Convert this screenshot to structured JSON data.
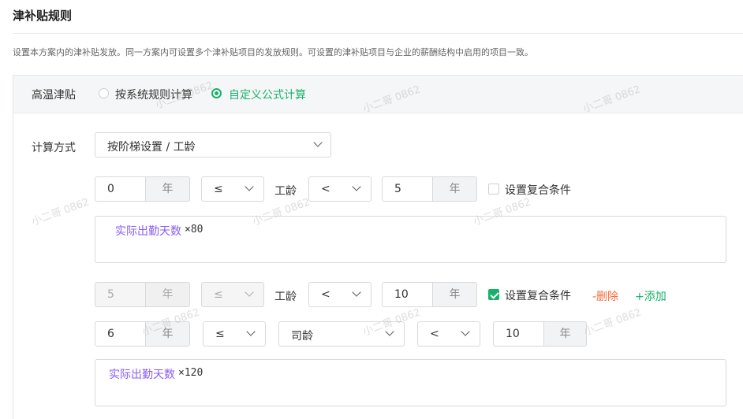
{
  "page": {
    "title": "津补贴规则",
    "description": "设置本方案内的津补贴发放。同一方案内可设置多个津补贴项目的发放规则。可设置的津补贴项目与企业的薪酬结构中启用的项目一致。"
  },
  "card": {
    "item_name": "高温津贴",
    "radio_options": [
      "按系统规则计算",
      "自定义公式计算"
    ],
    "selected_option": "自定义公式计算"
  },
  "calc": {
    "label": "计算方式",
    "method": "按阶梯设置 / 工龄"
  },
  "rule1": {
    "from_value": "0",
    "from_unit": "年",
    "op1": "≤",
    "field": "工龄",
    "op2": "<",
    "to_value": "5",
    "to_unit": "年",
    "compound_label": "设置复合条件",
    "compound_checked": false,
    "formula_var": "实际出勤天数",
    "formula_op": "×80"
  },
  "rule2": {
    "from_value": "5",
    "from_unit": "年",
    "op1": "≤",
    "field": "工龄",
    "op2": "<",
    "to_value": "10",
    "to_unit": "年",
    "compound_label": "设置复合条件",
    "compound_checked": true,
    "delete_label": "-删除",
    "add_label": "+添加",
    "sub": {
      "from_value": "6",
      "from_unit": "年",
      "op1": "≤",
      "field": "司龄",
      "op2": "<",
      "to_value": "10",
      "to_unit": "年"
    },
    "formula_var": "实际出勤天数",
    "formula_op": "×120"
  },
  "watermark": "小二哥 0862",
  "colors": {
    "accent": "#17b26a",
    "delete": "#f56c3c",
    "formula_var": "#8a5cf6"
  }
}
